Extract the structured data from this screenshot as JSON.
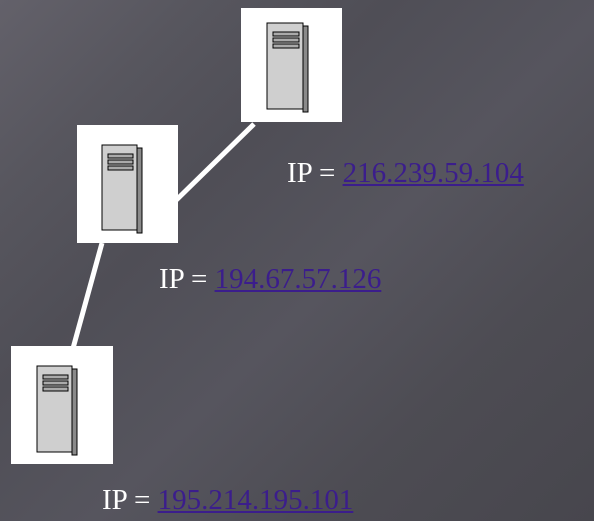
{
  "servers": [
    {
      "id": "top",
      "ip_prefix": "IP = ",
      "ip": "216.239.59.104"
    },
    {
      "id": "mid",
      "ip_prefix": "IP = ",
      "ip": "194.67.57.126"
    },
    {
      "id": "bot",
      "ip_prefix": "IP = ",
      "ip": "195.214.195.101"
    }
  ],
  "colors": {
    "link": "#3b1d8c",
    "label": "#ffffff",
    "connector": "#ffffff"
  }
}
